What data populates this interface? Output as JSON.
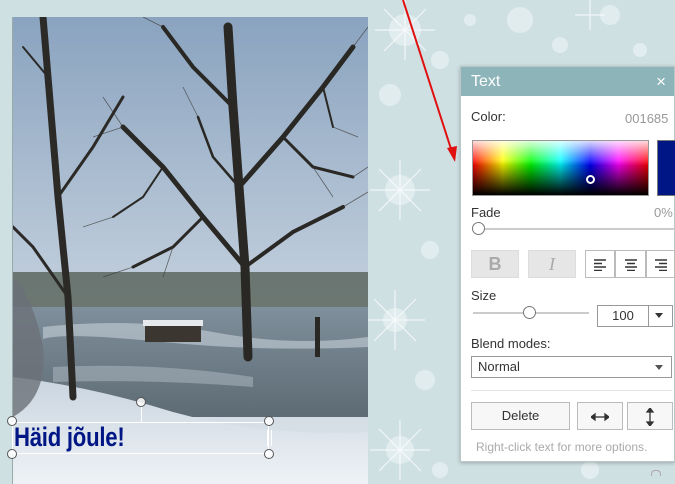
{
  "canvas": {
    "text_layer": {
      "content": "Häid jõule!",
      "color": "#001685"
    }
  },
  "text_panel": {
    "title": "Text",
    "close_glyph": "×",
    "color_label": "Color:",
    "color_hex": "001685",
    "color_value": "#001685",
    "fade_label": "Fade",
    "fade_value": "0%",
    "fade_level": 0,
    "bold_label": "B",
    "italic_label": "I",
    "align_left_icon": "align-left-icon",
    "align_center_icon": "align-center-icon",
    "align_right_icon": "align-right-icon",
    "size_label": "Size",
    "size_value": "100",
    "blend_label": "Blend modes:",
    "blend_value": "Normal",
    "delete_label": "Delete",
    "flip_horizontal_icon": "flip-horizontal-icon",
    "flip_vertical_icon": "flip-vertical-icon",
    "hint": "Right-click text for more options."
  },
  "colors": {
    "panel_header": "#8db4b8",
    "background": "#cfe0e3",
    "annotation_arrow": "#e01010"
  }
}
